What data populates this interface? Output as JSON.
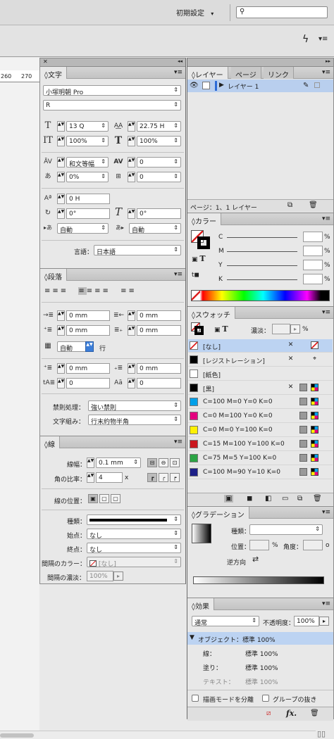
{
  "topbar": {
    "workspace": "初期設定",
    "workspace_arrow": "▾",
    "search_placeholder": ""
  },
  "ruler": {
    "ticks": [
      "260",
      "270"
    ]
  },
  "moji": {
    "title": "文字",
    "font_family": "小塚明朝 Pro",
    "font_style": "R",
    "size": "13 Q",
    "leading": "22.75 H",
    "vscale": "100%",
    "hscale": "100%",
    "tsume": "和文等幅",
    "tracking": "0",
    "aki": "0%",
    "baseline_kerning": "0",
    "shift": "0 H",
    "rotate": "0°",
    "skew": "0°",
    "mojiaki_before": "自動",
    "mojiaki_after": "自動",
    "lang_label": "言語：",
    "lang": "日本語"
  },
  "danraku": {
    "title": "段落",
    "left_indent": "0 mm",
    "right_indent": "0 mm",
    "first_indent": "0 mm",
    "last_indent": "0 mm",
    "grid": "自動",
    "grid_unit": "行",
    "space_before": "0 mm",
    "space_after": "0 mm",
    "dropcap_lines": "0",
    "dropcap_chars": "0",
    "kinsoku_label": "禁則処理：",
    "kinsoku": "強い禁則",
    "mojikumi_label": "文字組み：",
    "mojikumi": "行末約物半角"
  },
  "sen": {
    "title": "線",
    "width_label": "線幅：",
    "width": "0.1 mm",
    "ratio_label": "角の比率：",
    "ratio": "4",
    "ratio_unit": "x",
    "pos_label": "線の位置：",
    "type_label": "種類：",
    "start_label": "始点：",
    "start": "なし",
    "end_label": "終点：",
    "end": "なし",
    "gapcolor_label": "間隔のカラー：",
    "gapcolor": "[なし]",
    "gaptint_label": "間隔の濃淡：",
    "gaptint": "100%"
  },
  "layers": {
    "tabs": [
      "レイヤー",
      "ページ",
      "リンク"
    ],
    "items": [
      "レイヤー 1"
    ],
    "status": "ページ：1、1 レイヤー"
  },
  "color": {
    "title": "カラー",
    "channels": [
      "C",
      "M",
      "Y",
      "K"
    ],
    "unit": "%"
  },
  "swatches": {
    "title": "スウォッチ",
    "tint_label": "濃淡：",
    "tint_unit": "%",
    "items": [
      {
        "name": "[なし]",
        "color": "#ffffff"
      },
      {
        "name": "[レジストレーション]",
        "color": "#000000"
      },
      {
        "name": "[紙色]",
        "color": "#ffffff"
      },
      {
        "name": "[黒]",
        "color": "#000000"
      },
      {
        "name": "C=100 M=0 Y=0 K=0",
        "color": "#00a0e9"
      },
      {
        "name": "C=0 M=100 Y=0 K=0",
        "color": "#e4007f"
      },
      {
        "name": "C=0 M=0 Y=100 K=0",
        "color": "#fff100"
      },
      {
        "name": "C=15 M=100 Y=100 K=0",
        "color": "#c9171e"
      },
      {
        "name": "C=75 M=5 Y=100 K=0",
        "color": "#2ba444"
      },
      {
        "name": "C=100 M=90 Y=10 K=0",
        "color": "#1d2088"
      }
    ]
  },
  "gradient": {
    "title": "グラデーション",
    "type_label": "種類：",
    "pos_label": "位置：",
    "pos_unit": "%",
    "angle_label": "角度：",
    "angle_unit": "o",
    "reverse_label": "逆方向"
  },
  "effects": {
    "title": "効果",
    "blend": "通常",
    "opacity_label": "不透明度：",
    "opacity": "100%",
    "object_row": "オブジェクト：標準 100%",
    "rows": [
      {
        "label": "線：",
        "value": "標準 100%"
      },
      {
        "label": "塗り：",
        "value": "標準 100%"
      },
      {
        "label": "テキスト：",
        "value": "標準 100%"
      }
    ],
    "isolate": "描画モードを分離",
    "knockout": "グループの抜き"
  }
}
